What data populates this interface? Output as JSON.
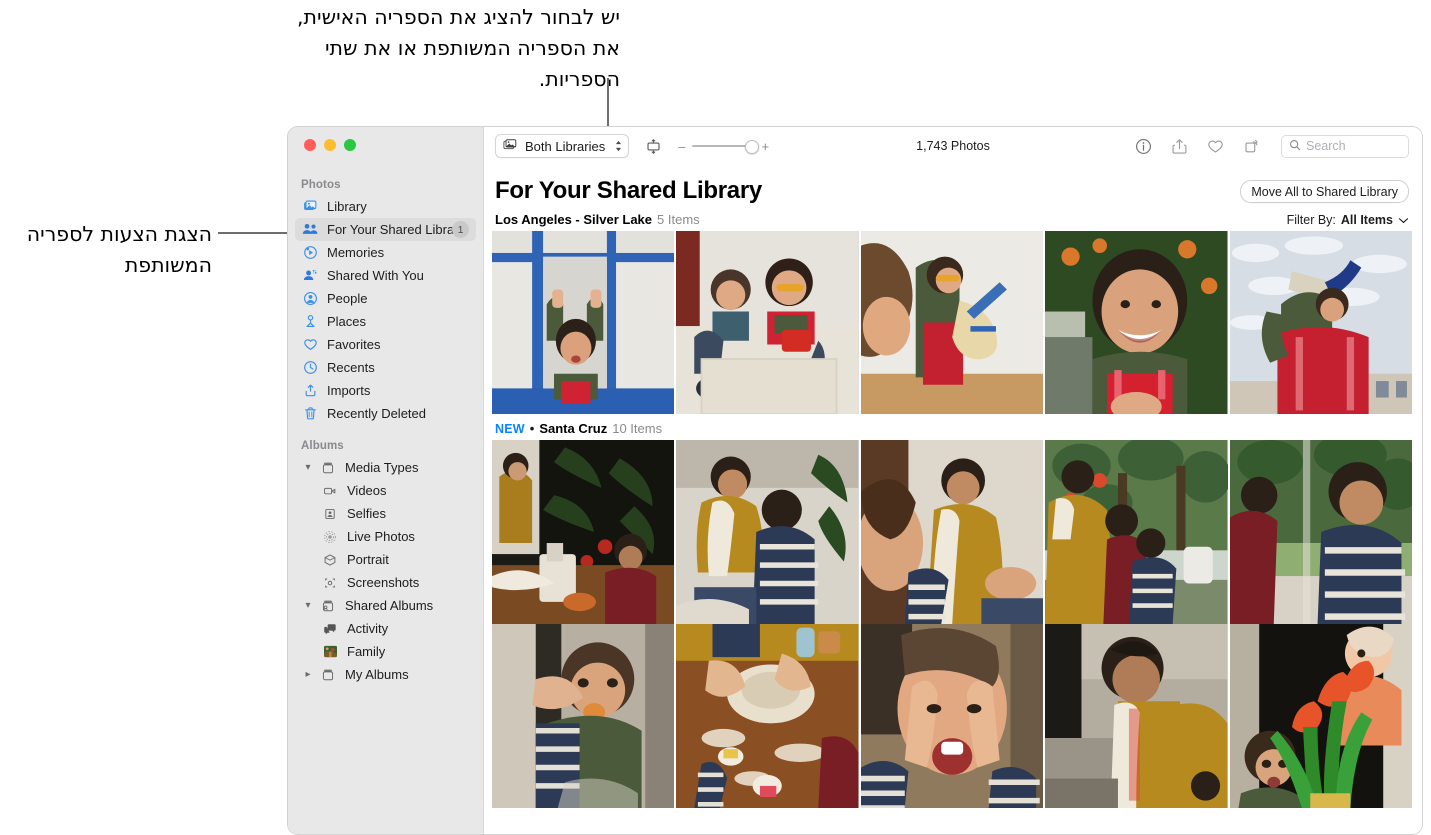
{
  "annotations": {
    "top": "יש לבחור להציג את הספריה האישית, את הספריה המשותפת או את שתי הספריות.",
    "left": "הצגת הצעות לספריה המשותפת"
  },
  "window": {
    "traffic_lights": [
      "close",
      "minimize",
      "zoom"
    ]
  },
  "sidebar": {
    "sections": [
      {
        "title": "Photos",
        "items": [
          {
            "label": "Library",
            "icon": "library-icon",
            "badge": "",
            "selected": false
          },
          {
            "label": "For Your Shared Library",
            "icon": "two-people-icon",
            "badge": "1",
            "selected": true
          },
          {
            "label": "Memories",
            "icon": "memories-icon",
            "badge": "",
            "selected": false
          },
          {
            "label": "Shared With You",
            "icon": "shared-with-you-icon",
            "badge": "",
            "selected": false
          },
          {
            "label": "People",
            "icon": "person-circle-icon",
            "badge": "",
            "selected": false
          },
          {
            "label": "Places",
            "icon": "map-pin-icon",
            "badge": "",
            "selected": false
          },
          {
            "label": "Favorites",
            "icon": "heart-icon",
            "badge": "",
            "selected": false
          },
          {
            "label": "Recents",
            "icon": "clock-icon",
            "badge": "",
            "selected": false
          },
          {
            "label": "Imports",
            "icon": "import-icon",
            "badge": "",
            "selected": false
          },
          {
            "label": "Recently Deleted",
            "icon": "trash-icon",
            "badge": "",
            "selected": false
          }
        ]
      },
      {
        "title": "Albums",
        "items": [
          {
            "label": "Media Types",
            "icon": "album-icon",
            "disclosure": "expanded",
            "level": 0
          },
          {
            "label": "Videos",
            "icon": "video-icon",
            "level": 1
          },
          {
            "label": "Selfies",
            "icon": "selfie-icon",
            "level": 1
          },
          {
            "label": "Live Photos",
            "icon": "live-photo-icon",
            "level": 1
          },
          {
            "label": "Portrait",
            "icon": "portrait-icon",
            "level": 1
          },
          {
            "label": "Screenshots",
            "icon": "screenshot-icon",
            "level": 1
          },
          {
            "label": "Shared Albums",
            "icon": "shared-album-icon",
            "disclosure": "expanded",
            "level": 0
          },
          {
            "label": "Activity",
            "icon": "activity-icon",
            "level": 1
          },
          {
            "label": "Family",
            "icon": "family-thumbnail-icon",
            "level": 1
          },
          {
            "label": "My Albums",
            "icon": "album-icon",
            "disclosure": "collapsed",
            "level": 0
          }
        ]
      }
    ]
  },
  "toolbar": {
    "library_popup": "Both Libraries",
    "aspect_icon": "aspect-ratio-icon",
    "zoom_minus": "–",
    "zoom_plus": "+",
    "photo_count": "1,743 Photos",
    "info_icon": "info-icon",
    "share_icon": "share-icon",
    "favorite_icon": "heart-icon",
    "rotate_icon": "rotate-icon",
    "search_placeholder": "Search",
    "search_value": "",
    "search_icon": "search-icon"
  },
  "main": {
    "title": "For Your Shared Library",
    "move_all_button": "Move All to Shared Library",
    "filter_label": "Filter By:",
    "filter_value": "All Items",
    "sections": [
      {
        "new_badge": "",
        "separator": "",
        "name": "Los Angeles - Silver Lake",
        "count": "5 Items"
      },
      {
        "new_badge": "NEW",
        "separator": "•",
        "name": "Santa Cruz",
        "count": "10 Items"
      }
    ]
  },
  "colors": {
    "accent": "#0a84ff",
    "sidebar_bg": "#e8e8e8",
    "selected_row": "#dcdcdc",
    "traffic_red": "#ff5f57",
    "traffic_yellow": "#febc2e",
    "traffic_green": "#28c840"
  }
}
